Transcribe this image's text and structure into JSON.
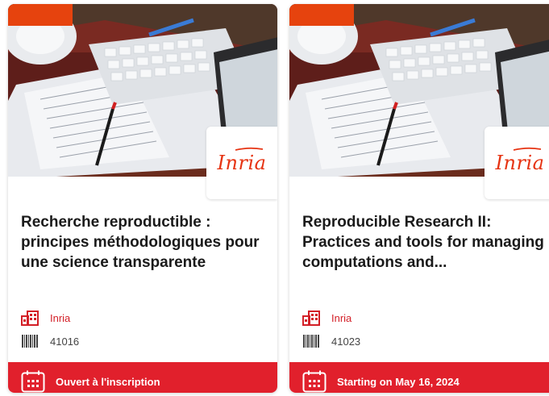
{
  "colors": {
    "accent_orange": "#e6430e",
    "brand_red": "#e1202c",
    "org_red": "#d31f27",
    "logo_red": "#e63312",
    "title_text": "#1a1a1a"
  },
  "courses": [
    {
      "title": "Recherche reproductible : principes méthodologiques pour une science transparente",
      "logo_text": "Inria",
      "organization": "Inria",
      "organization_icon": "organization-building-icon",
      "course_code": "41016",
      "course_code_icon": "barcode-icon",
      "status": "Ouvert à l'inscription",
      "status_icon": "calendar-icon"
    },
    {
      "title": "Reproducible Research II: Practices and tools for managing computations and...",
      "logo_text": "Inria",
      "organization": "Inria",
      "organization_icon": "organization-building-icon",
      "course_code": "41023",
      "course_code_icon": "barcode-icon",
      "status": "Starting on May 16, 2024",
      "status_icon": "calendar-icon"
    }
  ]
}
